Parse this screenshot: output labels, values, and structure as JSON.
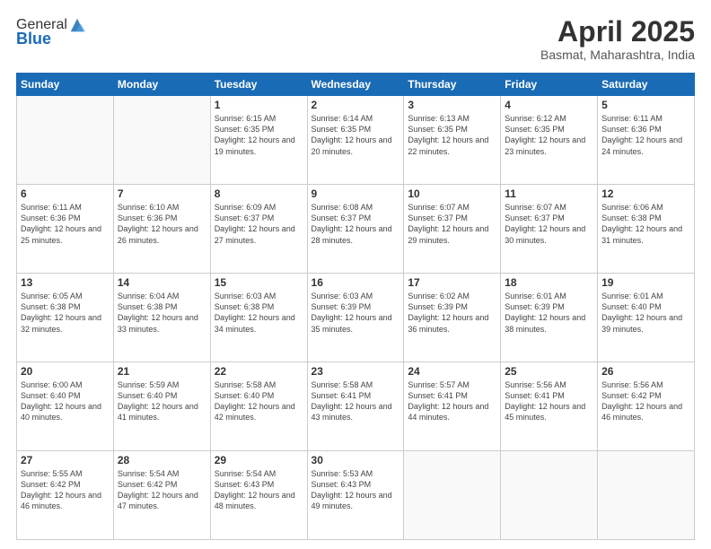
{
  "header": {
    "logo_general": "General",
    "logo_blue": "Blue",
    "month_title": "April 2025",
    "location": "Basmat, Maharashtra, India"
  },
  "days_of_week": [
    "Sunday",
    "Monday",
    "Tuesday",
    "Wednesday",
    "Thursday",
    "Friday",
    "Saturday"
  ],
  "weeks": [
    [
      {
        "day": "",
        "sunrise": "",
        "sunset": "",
        "daylight": "",
        "empty": true
      },
      {
        "day": "",
        "sunrise": "",
        "sunset": "",
        "daylight": "",
        "empty": true
      },
      {
        "day": "1",
        "sunrise": "Sunrise: 6:15 AM",
        "sunset": "Sunset: 6:35 PM",
        "daylight": "Daylight: 12 hours and 19 minutes."
      },
      {
        "day": "2",
        "sunrise": "Sunrise: 6:14 AM",
        "sunset": "Sunset: 6:35 PM",
        "daylight": "Daylight: 12 hours and 20 minutes."
      },
      {
        "day": "3",
        "sunrise": "Sunrise: 6:13 AM",
        "sunset": "Sunset: 6:35 PM",
        "daylight": "Daylight: 12 hours and 22 minutes."
      },
      {
        "day": "4",
        "sunrise": "Sunrise: 6:12 AM",
        "sunset": "Sunset: 6:35 PM",
        "daylight": "Daylight: 12 hours and 23 minutes."
      },
      {
        "day": "5",
        "sunrise": "Sunrise: 6:11 AM",
        "sunset": "Sunset: 6:36 PM",
        "daylight": "Daylight: 12 hours and 24 minutes."
      }
    ],
    [
      {
        "day": "6",
        "sunrise": "Sunrise: 6:11 AM",
        "sunset": "Sunset: 6:36 PM",
        "daylight": "Daylight: 12 hours and 25 minutes."
      },
      {
        "day": "7",
        "sunrise": "Sunrise: 6:10 AM",
        "sunset": "Sunset: 6:36 PM",
        "daylight": "Daylight: 12 hours and 26 minutes."
      },
      {
        "day": "8",
        "sunrise": "Sunrise: 6:09 AM",
        "sunset": "Sunset: 6:37 PM",
        "daylight": "Daylight: 12 hours and 27 minutes."
      },
      {
        "day": "9",
        "sunrise": "Sunrise: 6:08 AM",
        "sunset": "Sunset: 6:37 PM",
        "daylight": "Daylight: 12 hours and 28 minutes."
      },
      {
        "day": "10",
        "sunrise": "Sunrise: 6:07 AM",
        "sunset": "Sunset: 6:37 PM",
        "daylight": "Daylight: 12 hours and 29 minutes."
      },
      {
        "day": "11",
        "sunrise": "Sunrise: 6:07 AM",
        "sunset": "Sunset: 6:37 PM",
        "daylight": "Daylight: 12 hours and 30 minutes."
      },
      {
        "day": "12",
        "sunrise": "Sunrise: 6:06 AM",
        "sunset": "Sunset: 6:38 PM",
        "daylight": "Daylight: 12 hours and 31 minutes."
      }
    ],
    [
      {
        "day": "13",
        "sunrise": "Sunrise: 6:05 AM",
        "sunset": "Sunset: 6:38 PM",
        "daylight": "Daylight: 12 hours and 32 minutes."
      },
      {
        "day": "14",
        "sunrise": "Sunrise: 6:04 AM",
        "sunset": "Sunset: 6:38 PM",
        "daylight": "Daylight: 12 hours and 33 minutes."
      },
      {
        "day": "15",
        "sunrise": "Sunrise: 6:03 AM",
        "sunset": "Sunset: 6:38 PM",
        "daylight": "Daylight: 12 hours and 34 minutes."
      },
      {
        "day": "16",
        "sunrise": "Sunrise: 6:03 AM",
        "sunset": "Sunset: 6:39 PM",
        "daylight": "Daylight: 12 hours and 35 minutes."
      },
      {
        "day": "17",
        "sunrise": "Sunrise: 6:02 AM",
        "sunset": "Sunset: 6:39 PM",
        "daylight": "Daylight: 12 hours and 36 minutes."
      },
      {
        "day": "18",
        "sunrise": "Sunrise: 6:01 AM",
        "sunset": "Sunset: 6:39 PM",
        "daylight": "Daylight: 12 hours and 38 minutes."
      },
      {
        "day": "19",
        "sunrise": "Sunrise: 6:01 AM",
        "sunset": "Sunset: 6:40 PM",
        "daylight": "Daylight: 12 hours and 39 minutes."
      }
    ],
    [
      {
        "day": "20",
        "sunrise": "Sunrise: 6:00 AM",
        "sunset": "Sunset: 6:40 PM",
        "daylight": "Daylight: 12 hours and 40 minutes."
      },
      {
        "day": "21",
        "sunrise": "Sunrise: 5:59 AM",
        "sunset": "Sunset: 6:40 PM",
        "daylight": "Daylight: 12 hours and 41 minutes."
      },
      {
        "day": "22",
        "sunrise": "Sunrise: 5:58 AM",
        "sunset": "Sunset: 6:40 PM",
        "daylight": "Daylight: 12 hours and 42 minutes."
      },
      {
        "day": "23",
        "sunrise": "Sunrise: 5:58 AM",
        "sunset": "Sunset: 6:41 PM",
        "daylight": "Daylight: 12 hours and 43 minutes."
      },
      {
        "day": "24",
        "sunrise": "Sunrise: 5:57 AM",
        "sunset": "Sunset: 6:41 PM",
        "daylight": "Daylight: 12 hours and 44 minutes."
      },
      {
        "day": "25",
        "sunrise": "Sunrise: 5:56 AM",
        "sunset": "Sunset: 6:41 PM",
        "daylight": "Daylight: 12 hours and 45 minutes."
      },
      {
        "day": "26",
        "sunrise": "Sunrise: 5:56 AM",
        "sunset": "Sunset: 6:42 PM",
        "daylight": "Daylight: 12 hours and 46 minutes."
      }
    ],
    [
      {
        "day": "27",
        "sunrise": "Sunrise: 5:55 AM",
        "sunset": "Sunset: 6:42 PM",
        "daylight": "Daylight: 12 hours and 46 minutes."
      },
      {
        "day": "28",
        "sunrise": "Sunrise: 5:54 AM",
        "sunset": "Sunset: 6:42 PM",
        "daylight": "Daylight: 12 hours and 47 minutes."
      },
      {
        "day": "29",
        "sunrise": "Sunrise: 5:54 AM",
        "sunset": "Sunset: 6:43 PM",
        "daylight": "Daylight: 12 hours and 48 minutes."
      },
      {
        "day": "30",
        "sunrise": "Sunrise: 5:53 AM",
        "sunset": "Sunset: 6:43 PM",
        "daylight": "Daylight: 12 hours and 49 minutes."
      },
      {
        "day": "",
        "sunrise": "",
        "sunset": "",
        "daylight": "",
        "empty": true
      },
      {
        "day": "",
        "sunrise": "",
        "sunset": "",
        "daylight": "",
        "empty": true
      },
      {
        "day": "",
        "sunrise": "",
        "sunset": "",
        "daylight": "",
        "empty": true
      }
    ]
  ]
}
